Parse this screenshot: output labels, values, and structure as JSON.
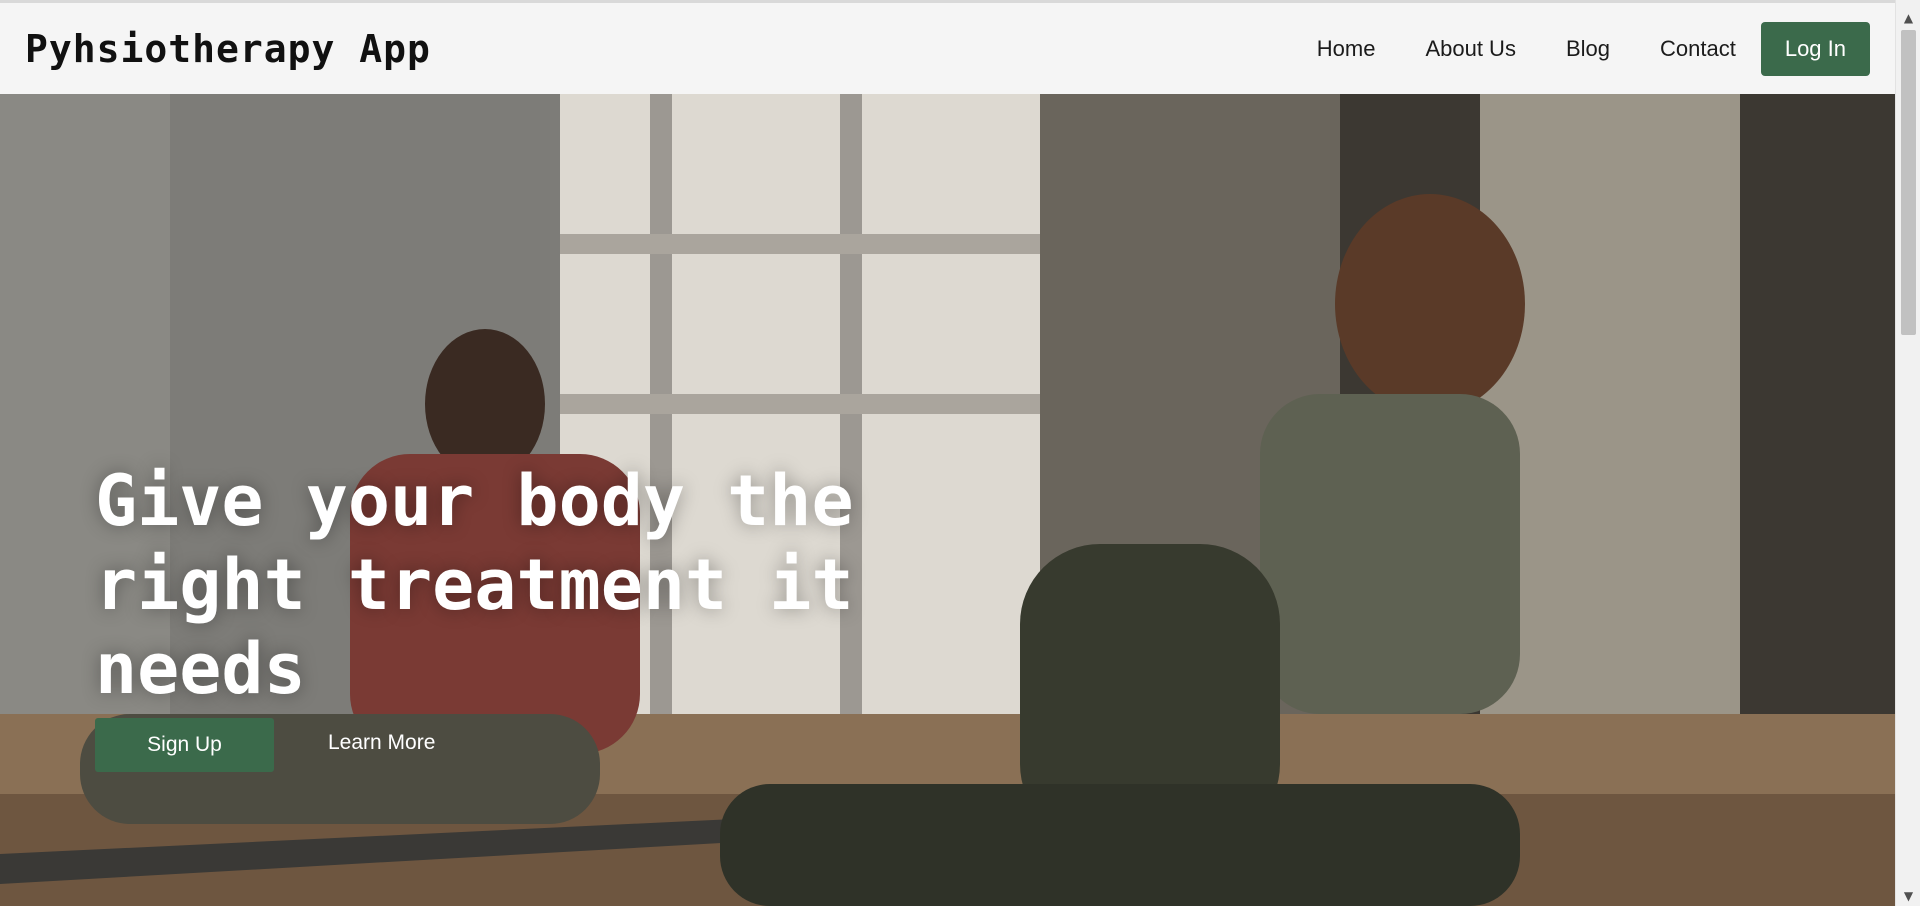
{
  "header": {
    "brand": "Pyhsiotherapy App",
    "nav": [
      "Home",
      "About Us",
      "Blog",
      "Contact"
    ],
    "login_label": "Log In"
  },
  "hero": {
    "title": "Give your body the right treatment it needs",
    "signup_label": "Sign Up",
    "learn_more_label": "Learn More"
  },
  "colors": {
    "accent": "#3b6a4b",
    "navbar_bg": "#f5f5f5"
  }
}
